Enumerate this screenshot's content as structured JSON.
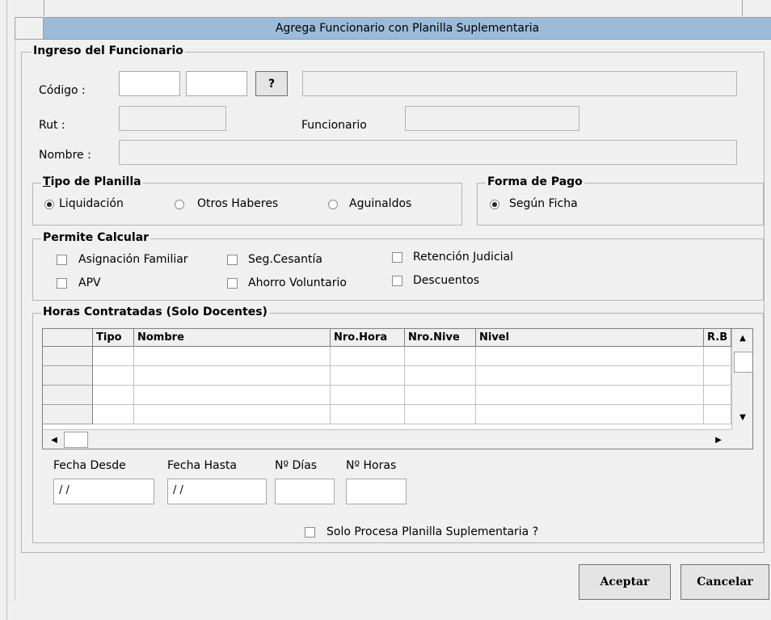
{
  "window": {
    "title": "Agrega Funcionario con Planilla Suplementaria"
  },
  "ingreso": {
    "legend": "Ingreso del Funcionario",
    "codigo_label": "Código :",
    "lookup_label": "?",
    "rut_label": "Rut :",
    "funcionario_label": "Funcionario",
    "nombre_label": "Nombre :"
  },
  "tipo_planilla": {
    "legend": "Tipo de Planilla",
    "options": [
      "Liquidación",
      "Otros Haberes",
      "Aguinaldos"
    ],
    "selected": "Liquidación"
  },
  "forma_pago": {
    "legend": "Forma de Pago",
    "options": [
      "Según Ficha"
    ],
    "selected": "Según Ficha"
  },
  "permite_calcular": {
    "legend": "Permite Calcular",
    "options": [
      "Asignación Familiar",
      "Seg.Cesantía",
      "Retención Judicial",
      "APV",
      "Ahorro Voluntario",
      "Descuentos"
    ]
  },
  "horas": {
    "legend": "Horas Contratadas (Solo Docentes)",
    "columns": [
      "Tipo",
      "Nombre",
      "Nro.Hora",
      "Nro.Nive",
      "Nivel",
      "R.B"
    ],
    "fecha_desde_label": "Fecha Desde",
    "fecha_hasta_label": "Fecha Hasta",
    "dias_label": "Nº Días",
    "horas_label": "Nº Horas",
    "fecha_desde_value": " / /",
    "fecha_hasta_value": " / /",
    "solo_procesa_label": "Solo Procesa Planilla Suplementaria ?"
  },
  "buttons": {
    "aceptar": "Aceptar",
    "cancelar": "Cancelar"
  },
  "icons": {
    "scroll_up": "▲",
    "scroll_down": "▼",
    "scroll_left": "◀",
    "scroll_right": "▶"
  }
}
